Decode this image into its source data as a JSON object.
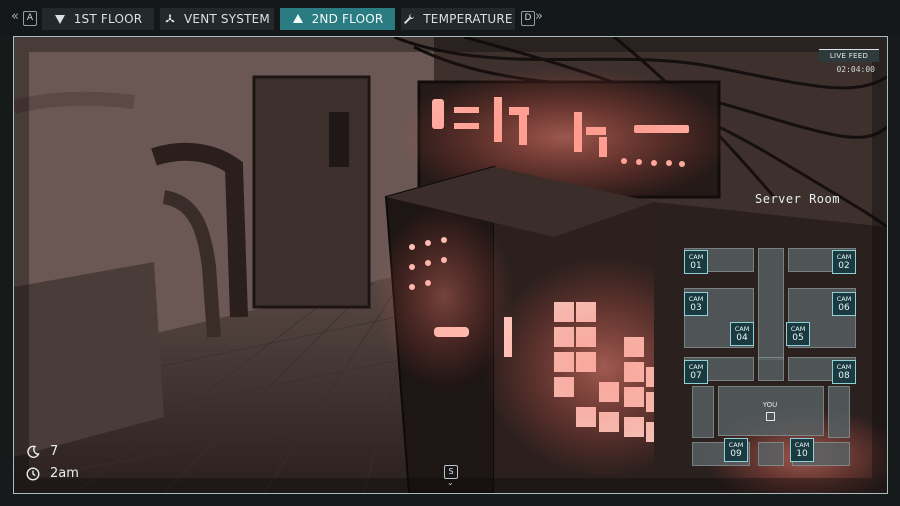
{
  "nav": {
    "prev_key": "A",
    "next_key": "D",
    "prev_chevron": "«",
    "next_chevron": "»",
    "tabs": [
      {
        "label": "1ST FLOOR",
        "icon": "triangle-down-icon",
        "active": false
      },
      {
        "label": "VENT SYSTEM",
        "icon": "fan-icon",
        "active": false
      },
      {
        "label": "2ND FLOOR",
        "icon": "triangle-up-icon",
        "active": true
      },
      {
        "label": "TEMPERATURE",
        "icon": "wrench-icon",
        "active": false
      }
    ]
  },
  "feed": {
    "badge": "LIVE FEED",
    "time": "02:04:00"
  },
  "map": {
    "room_name": "Server Room",
    "cameras": [
      {
        "label": "CAM",
        "num": "01"
      },
      {
        "label": "CAM",
        "num": "02"
      },
      {
        "label": "CAM",
        "num": "03"
      },
      {
        "label": "CAM",
        "num": "04"
      },
      {
        "label": "CAM",
        "num": "05"
      },
      {
        "label": "CAM",
        "num": "06"
      },
      {
        "label": "CAM",
        "num": "07"
      },
      {
        "label": "CAM",
        "num": "08"
      },
      {
        "label": "CAM",
        "num": "09"
      },
      {
        "label": "CAM",
        "num": "10"
      }
    ],
    "you_label": "YOU"
  },
  "stats": {
    "night": "7",
    "time": "2am"
  },
  "scroll_key": "S",
  "colors": {
    "accent": "#2b7b82",
    "panel": "#23292b",
    "frame_border": "#a9bcc0",
    "glow": "#ff6a5a"
  }
}
